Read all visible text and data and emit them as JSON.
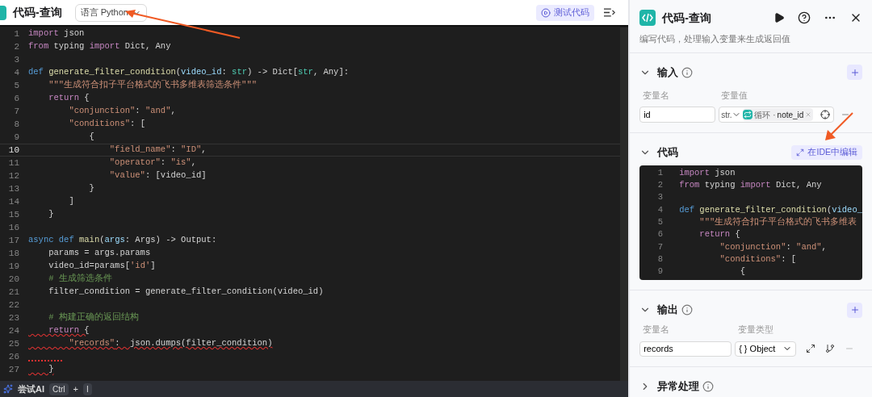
{
  "editor": {
    "title": "代码-查询",
    "language_select": "语言 Python",
    "test_button": "测试代码",
    "lines": [
      {
        "number": "1",
        "current": false,
        "error": false,
        "tokens": [
          {
            "text": "import",
            "kind": "kw"
          },
          {
            "text": " json",
            "kind": "p"
          }
        ]
      },
      {
        "number": "2",
        "current": false,
        "error": false,
        "tokens": [
          {
            "text": "from",
            "kind": "kw"
          },
          {
            "text": " typing ",
            "kind": "p"
          },
          {
            "text": "import",
            "kind": "kw"
          },
          {
            "text": " Dict, Any",
            "kind": "p"
          }
        ]
      },
      {
        "number": "3",
        "current": false,
        "error": false
      },
      {
        "number": "4",
        "current": false,
        "error": false,
        "tokens": [
          {
            "text": "def",
            "kind": "def"
          },
          {
            "text": " generate_filter_condition",
            "kind": "fn"
          },
          {
            "text": "(",
            "kind": "p"
          },
          {
            "text": "video_id",
            "kind": "var"
          },
          {
            "text": ": ",
            "kind": "p"
          },
          {
            "text": "str",
            "kind": "type"
          },
          {
            "text": ") -> Dict[",
            "kind": "p"
          },
          {
            "text": "str",
            "kind": "type"
          },
          {
            "text": ", Any]:",
            "kind": "p"
          }
        ]
      },
      {
        "number": "5",
        "current": false,
        "error": false,
        "tokens": [
          {
            "text": "    \"\"\"生成符合扣子平台格式的飞书多维表筛选条件\"\"\"",
            "kind": "str"
          }
        ]
      },
      {
        "number": "6",
        "current": false,
        "error": false,
        "tokens": [
          {
            "text": "    return",
            "kind": "kw"
          },
          {
            "text": " {",
            "kind": "p"
          }
        ]
      },
      {
        "number": "7",
        "current": false,
        "error": false,
        "tokens": [
          {
            "text": "        \"conjunction\"",
            "kind": "str"
          },
          {
            "text": ": ",
            "kind": "p"
          },
          {
            "text": "\"and\"",
            "kind": "str"
          },
          {
            "text": ",",
            "kind": "p"
          }
        ]
      },
      {
        "number": "8",
        "current": false,
        "error": false,
        "tokens": [
          {
            "text": "        \"conditions\"",
            "kind": "str"
          },
          {
            "text": ": [",
            "kind": "p"
          }
        ]
      },
      {
        "number": "9",
        "current": false,
        "error": false,
        "tokens": [
          {
            "text": "            {",
            "kind": "p"
          }
        ]
      },
      {
        "number": "10",
        "current": true,
        "error": false,
        "tokens": [
          {
            "text": "                \"field_name\"",
            "kind": "str"
          },
          {
            "text": ": ",
            "kind": "p"
          },
          {
            "text": "\"ID\"",
            "kind": "str"
          },
          {
            "text": ",",
            "kind": "p"
          }
        ]
      },
      {
        "number": "11",
        "current": false,
        "error": false,
        "tokens": [
          {
            "text": "                \"operator\"",
            "kind": "str"
          },
          {
            "text": ": ",
            "kind": "p"
          },
          {
            "text": "\"is\"",
            "kind": "str"
          },
          {
            "text": ",",
            "kind": "p"
          }
        ]
      },
      {
        "number": "12",
        "current": false,
        "error": false,
        "tokens": [
          {
            "text": "                \"value\"",
            "kind": "str"
          },
          {
            "text": ": [video_id]",
            "kind": "p"
          }
        ]
      },
      {
        "number": "13",
        "current": false,
        "error": false,
        "tokens": [
          {
            "text": "            }",
            "kind": "p"
          }
        ]
      },
      {
        "number": "14",
        "current": false,
        "error": false,
        "tokens": [
          {
            "text": "        ]",
            "kind": "p"
          }
        ]
      },
      {
        "number": "15",
        "current": false,
        "error": false,
        "tokens": [
          {
            "text": "    }",
            "kind": "p"
          }
        ]
      },
      {
        "number": "16",
        "current": false,
        "error": false
      },
      {
        "number": "17",
        "current": false,
        "error": false,
        "tokens": [
          {
            "text": "async def",
            "kind": "def"
          },
          {
            "text": " main",
            "kind": "fn"
          },
          {
            "text": "(",
            "kind": "p"
          },
          {
            "text": "args",
            "kind": "var"
          },
          {
            "text": ": Args) -> Output:",
            "kind": "p"
          }
        ]
      },
      {
        "number": "18",
        "current": false,
        "error": false,
        "tokens": [
          {
            "text": "    params = args.params",
            "kind": "p"
          }
        ]
      },
      {
        "number": "19",
        "current": false,
        "error": false,
        "tokens": [
          {
            "text": "    video_id=params[",
            "kind": "p"
          },
          {
            "text": "'id'",
            "kind": "str"
          },
          {
            "text": "]",
            "kind": "p"
          }
        ]
      },
      {
        "number": "20",
        "current": false,
        "error": false,
        "tokens": [
          {
            "text": "    # 生成筛选条件",
            "kind": "cm"
          }
        ]
      },
      {
        "number": "21",
        "current": false,
        "error": false,
        "tokens": [
          {
            "text": "    filter_condition = generate_filter_condition(video_id)",
            "kind": "p"
          }
        ]
      },
      {
        "number": "22",
        "current": false,
        "error": false
      },
      {
        "number": "23",
        "current": false,
        "error": false,
        "tokens": [
          {
            "text": "    # 构建正确的返回结构",
            "kind": "cm"
          }
        ]
      },
      {
        "number": "24",
        "current": false,
        "error": true,
        "tokens": [
          {
            "text": "    return",
            "kind": "kw"
          },
          {
            "text": " {",
            "kind": "p"
          }
        ]
      },
      {
        "number": "25",
        "current": false,
        "error": true,
        "tokens": [
          {
            "text": "        \"records\"",
            "kind": "str"
          },
          {
            "text": ":  json.dumps(filter_condition)",
            "kind": "p"
          }
        ]
      },
      {
        "number": "26",
        "current": false,
        "error": true
      },
      {
        "number": "27",
        "current": false,
        "error": true,
        "tokens": [
          {
            "text": "    }",
            "kind": "p"
          }
        ]
      }
    ],
    "ai_bar": {
      "label": "尝试AI",
      "keys": [
        "Ctrl",
        "+",
        "I"
      ]
    }
  },
  "panel": {
    "title": "代码-查询",
    "description": "编写代码，处理输入变量来生成返回值",
    "input": {
      "title": "输入",
      "expanded": true,
      "name_label": "变量名",
      "value_label": "变量值",
      "rows": [
        {
          "name": "id",
          "type": "str.",
          "ref_source": "循环 ·",
          "ref_name": "note_id"
        }
      ]
    },
    "code": {
      "title": "代码",
      "expanded": true,
      "ide_button": "在IDE中编辑",
      "lines": [
        {
          "number": "1",
          "tokens": [
            {
              "text": "import",
              "kind": "kw"
            },
            {
              "text": " json",
              "kind": "p"
            }
          ]
        },
        {
          "number": "2",
          "tokens": [
            {
              "text": "from",
              "kind": "kw"
            },
            {
              "text": " typing ",
              "kind": "p"
            },
            {
              "text": "import",
              "kind": "kw"
            },
            {
              "text": " Dict, Any",
              "kind": "p"
            }
          ]
        },
        {
          "number": "3"
        },
        {
          "number": "4",
          "tokens": [
            {
              "text": "def",
              "kind": "def"
            },
            {
              "text": " generate_filter_condition",
              "kind": "fn"
            },
            {
              "text": "(",
              "kind": "p"
            },
            {
              "text": "video_",
              "kind": "var"
            }
          ]
        },
        {
          "number": "5",
          "tokens": [
            {
              "text": "    \"\"\"生成符合扣子平台格式的飞书多维表",
              "kind": "str"
            }
          ]
        },
        {
          "number": "6",
          "tokens": [
            {
              "text": "    return",
              "kind": "kw"
            },
            {
              "text": " {",
              "kind": "p"
            }
          ]
        },
        {
          "number": "7",
          "tokens": [
            {
              "text": "        \"conjunction\"",
              "kind": "str"
            },
            {
              "text": ": ",
              "kind": "p"
            },
            {
              "text": "\"and\"",
              "kind": "str"
            },
            {
              "text": ",",
              "kind": "p"
            }
          ]
        },
        {
          "number": "8",
          "tokens": [
            {
              "text": "        \"conditions\"",
              "kind": "str"
            },
            {
              "text": ": [",
              "kind": "p"
            }
          ]
        },
        {
          "number": "9",
          "tokens": [
            {
              "text": "            {",
              "kind": "p"
            }
          ]
        }
      ]
    },
    "output": {
      "title": "输出",
      "expanded": true,
      "name_label": "变量名",
      "type_label": "变量类型",
      "rows": [
        {
          "name": "records",
          "type": "{ } Object"
        }
      ]
    },
    "error_handling": {
      "title": "异常处理",
      "expanded": false
    }
  }
}
